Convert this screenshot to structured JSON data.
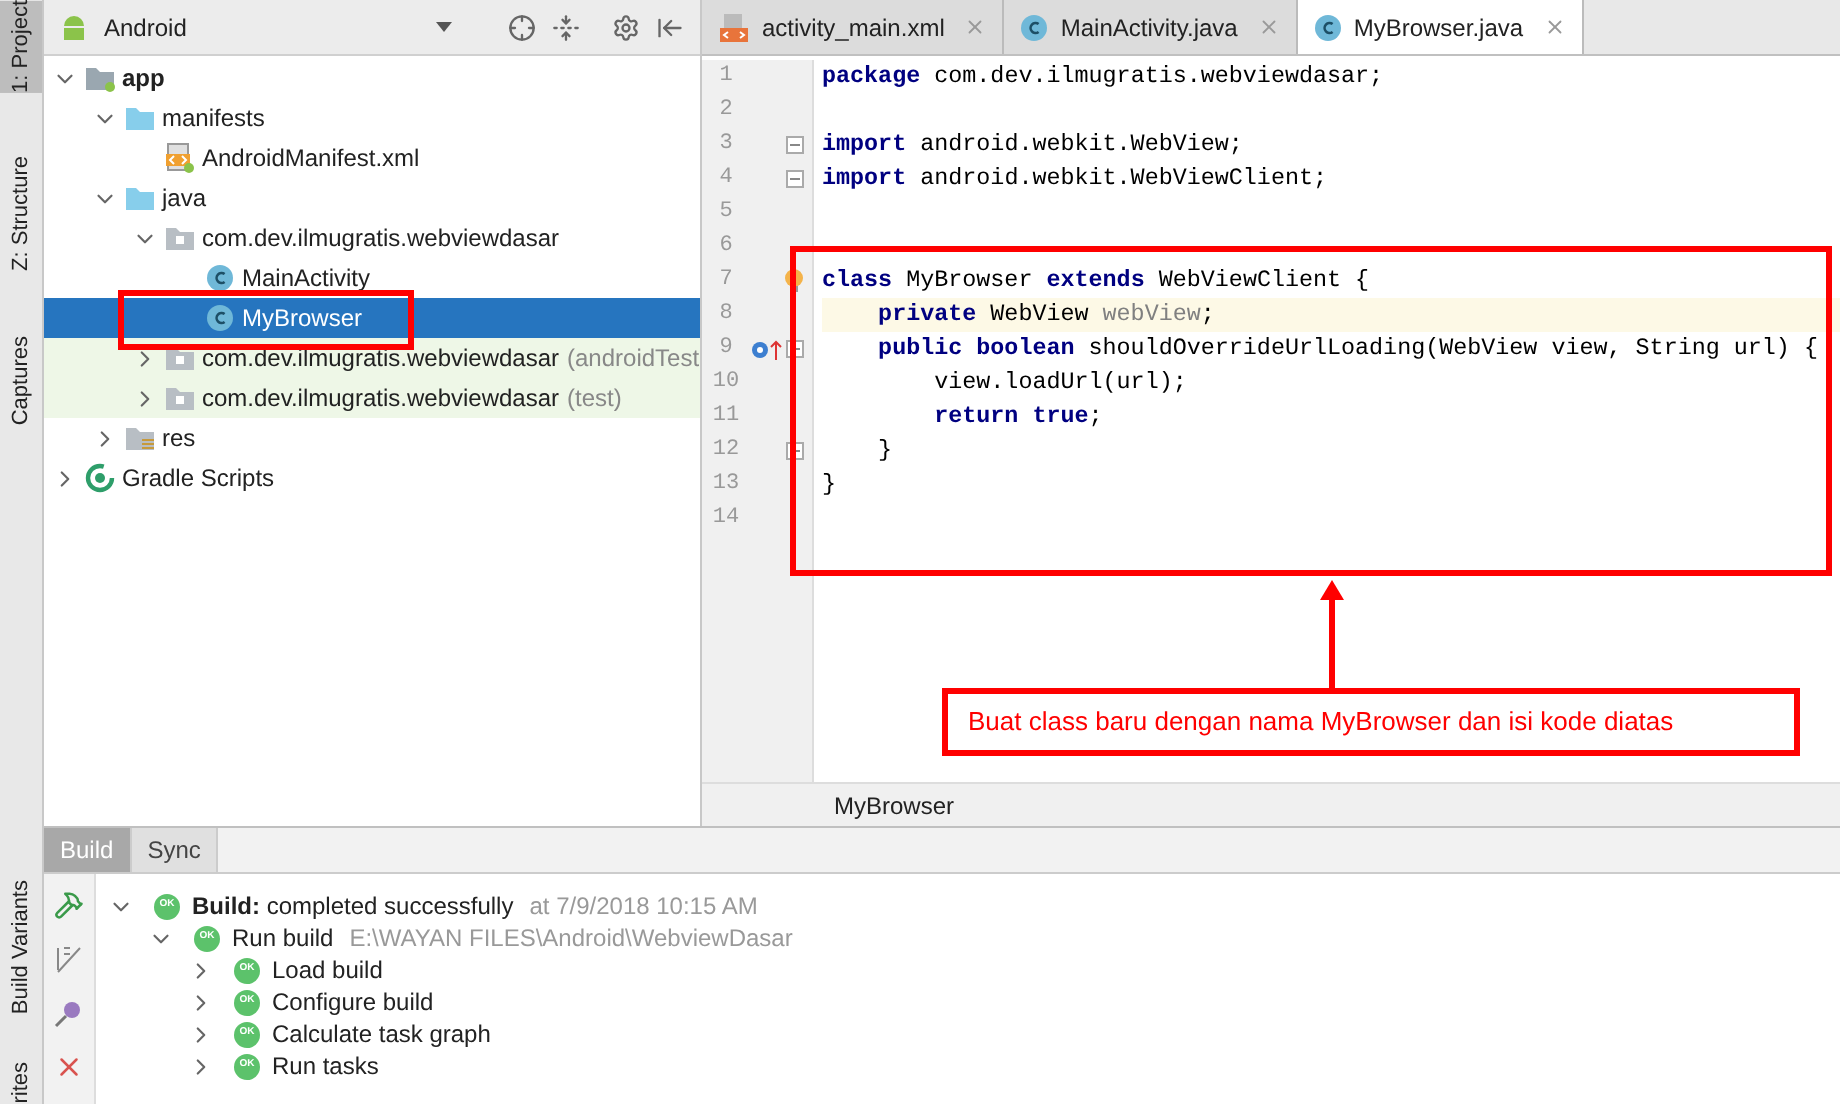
{
  "side_stripe": [
    {
      "label": "1: Project",
      "selected": true
    },
    {
      "label": "Z: Structure",
      "selected": false
    },
    {
      "label": "Captures",
      "selected": false
    }
  ],
  "side_stripe_bottom": [
    {
      "label": "Build Variants"
    },
    {
      "label": "rites"
    }
  ],
  "project": {
    "view": "Android",
    "tree": [
      {
        "label": "app",
        "bold": true,
        "kind": "module",
        "expanded": true,
        "selected": false,
        "highlighted": false,
        "children": [
          {
            "label": "manifests",
            "kind": "folder",
            "expanded": true,
            "selected": false,
            "highlighted": false,
            "children": [
              {
                "label": "AndroidManifest.xml",
                "kind": "manifest",
                "selected": false,
                "highlighted": false
              }
            ]
          },
          {
            "label": "java",
            "kind": "folder",
            "expanded": true,
            "selected": false,
            "highlighted": false,
            "children": [
              {
                "label": "com.dev.ilmugratis.webviewdasar",
                "kind": "package",
                "expanded": true,
                "selected": false,
                "highlighted": false,
                "children": [
                  {
                    "label": "MainActivity",
                    "kind": "class",
                    "selected": false,
                    "highlighted": false
                  },
                  {
                    "label": "MyBrowser",
                    "kind": "class",
                    "selected": true,
                    "highlighted": false
                  }
                ]
              },
              {
                "label": "com.dev.ilmugratis.webviewdasar",
                "suffix": "(androidTest",
                "kind": "package",
                "expanded": false,
                "selected": false,
                "highlighted": true
              },
              {
                "label": "com.dev.ilmugratis.webviewdasar",
                "suffix": "(test)",
                "kind": "package",
                "expanded": false,
                "selected": false,
                "highlighted": true
              }
            ]
          },
          {
            "label": "res",
            "kind": "res",
            "expanded": false,
            "selected": false,
            "highlighted": false
          }
        ]
      },
      {
        "label": "Gradle Scripts",
        "kind": "gradle",
        "expanded": false,
        "selected": false,
        "highlighted": false
      }
    ]
  },
  "editor_tabs": [
    {
      "label": "activity_main.xml",
      "kind": "xml",
      "selected": false
    },
    {
      "label": "MainActivity.java",
      "kind": "class",
      "selected": false
    },
    {
      "label": "MyBrowser.java",
      "kind": "class",
      "selected": true
    }
  ],
  "code": [
    {
      "number": "1",
      "tokens": [
        {
          "kind": "kw",
          "text": "package"
        },
        {
          "kind": "plain",
          "text": " com.dev.ilmugratis.webviewdasar;"
        }
      ]
    },
    {
      "number": "2"
    },
    {
      "number": "3",
      "fold": true,
      "tokens": [
        {
          "kind": "kw",
          "text": "import"
        },
        {
          "kind": "plain",
          "text": " android.webkit.WebView;"
        }
      ]
    },
    {
      "number": "4",
      "fold": true,
      "tokens": [
        {
          "kind": "kw",
          "text": "import"
        },
        {
          "kind": "plain",
          "text": " android.webkit.WebViewClient;"
        }
      ]
    },
    {
      "number": "5"
    },
    {
      "number": "6"
    },
    {
      "number": "7",
      "bulb": true,
      "tokens": [
        {
          "kind": "kw",
          "text": "class"
        },
        {
          "kind": "plain",
          "text": " MyBrowser "
        },
        {
          "kind": "kw",
          "text": "extends"
        },
        {
          "kind": "plain",
          "text": " WebViewClient {"
        }
      ]
    },
    {
      "number": "8",
      "current": true,
      "tokens": [
        {
          "kind": "kw",
          "text": "    private"
        },
        {
          "kind": "plain",
          "text": " WebView "
        },
        {
          "kind": "unused",
          "text": "webView"
        },
        {
          "kind": "plain",
          "text": ";"
        }
      ]
    },
    {
      "number": "9",
      "override": true,
      "fold": true,
      "tokens": [
        {
          "kind": "kw",
          "text": "    public boolean"
        },
        {
          "kind": "plain",
          "text": " shouldOverrideUrlLoading(WebView view, String url) {"
        }
      ]
    },
    {
      "number": "10",
      "tokens": [
        {
          "kind": "plain",
          "text": "        view.loadUrl(url);"
        }
      ]
    },
    {
      "number": "11",
      "tokens": [
        {
          "kind": "kw",
          "text": "        return true"
        },
        {
          "kind": "plain",
          "text": ";"
        }
      ]
    },
    {
      "number": "12",
      "fold": true,
      "tokens": [
        {
          "kind": "plain",
          "text": "    }"
        }
      ]
    },
    {
      "number": "13",
      "tokens": [
        {
          "kind": "plain",
          "text": "}"
        }
      ]
    },
    {
      "number": "14"
    }
  ],
  "annotation": "Buat class baru dengan nama MyBrowser dan isi kode diatas",
  "breadcrumb": "MyBrowser",
  "build": {
    "tabs": [
      {
        "label": "Build",
        "selected": true
      },
      {
        "label": "Sync",
        "selected": false
      }
    ],
    "tree": [
      {
        "label": "Build:",
        "rest": " completed successfully",
        "detail": "at 7/9/2018 10:15 AM",
        "badge": "OK",
        "expanded": true,
        "children": [
          {
            "label": "Run build",
            "detail": "E:\\WAYAN FILES\\Android\\WebviewDasar",
            "badge": "OK",
            "expanded": true,
            "children": [
              {
                "label": "Load build",
                "badge": "OK",
                "expanded": false
              },
              {
                "label": "Configure build",
                "badge": "OK",
                "expanded": false
              },
              {
                "label": "Calculate task graph",
                "badge": "OK",
                "expanded": false
              },
              {
                "label": "Run tasks",
                "badge": "OK",
                "expanded": false
              }
            ]
          }
        ]
      }
    ]
  }
}
